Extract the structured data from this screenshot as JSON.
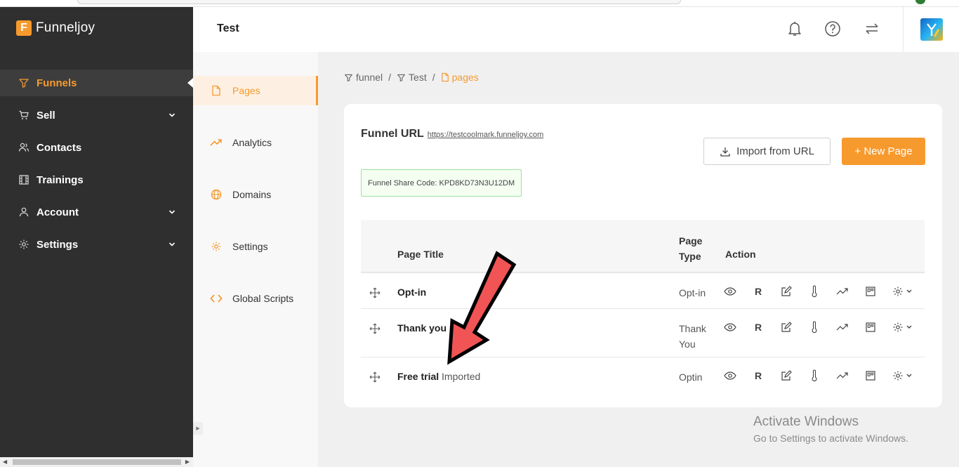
{
  "app": {
    "name": "Funneljoy",
    "logo_letter": "F",
    "accent": "#f79a2e"
  },
  "sidebar": {
    "items": [
      {
        "label": "Funnels",
        "icon": "funnel-icon",
        "active": true
      },
      {
        "label": "Sell",
        "icon": "cart-icon",
        "has_children": true
      },
      {
        "label": "Contacts",
        "icon": "users-icon"
      },
      {
        "label": "Trainings",
        "icon": "film-icon"
      },
      {
        "label": "Account",
        "icon": "user-icon",
        "has_children": true
      },
      {
        "label": "Settings",
        "icon": "gear-icon",
        "has_children": true
      }
    ]
  },
  "header": {
    "title": "Test",
    "icons": [
      "bell-icon",
      "help-icon",
      "switch-icon",
      "avatar"
    ]
  },
  "subnav": {
    "items": [
      {
        "label": "Pages",
        "icon": "page-icon",
        "active": true
      },
      {
        "label": "Analytics",
        "icon": "trend-icon"
      },
      {
        "label": "Domains",
        "icon": "globe-icon"
      },
      {
        "label": "Settings",
        "icon": "gear-icon"
      },
      {
        "label": "Global Scripts",
        "icon": "code-icon"
      }
    ]
  },
  "breadcrumb": {
    "items": [
      "funnel",
      "Test",
      "pages"
    ],
    "separator": "/"
  },
  "card": {
    "funnel_url_label": "Funnel URL",
    "funnel_url": "https://testcoolmark.funneljoy.com",
    "share_code": "Funnel Share Code: KPD8KD73N3U12DM",
    "import_label": "Import from URL",
    "new_page_label": "+ New Page"
  },
  "table": {
    "headers": {
      "title": "Page Title",
      "type": "Page Type",
      "action": "Action"
    },
    "action_icons": [
      "eye-icon",
      "r-icon",
      "edit-icon",
      "thermometer-icon",
      "trend-icon",
      "template-icon",
      "gear-dropdown-icon"
    ],
    "action_r_label": "R",
    "rows": [
      {
        "title": "Opt-in",
        "tag": "",
        "type": "Opt-in"
      },
      {
        "title": "Thank you",
        "tag": "",
        "type": "Thank You"
      },
      {
        "title": "Free trial",
        "tag": "Imported",
        "type": "Optin"
      }
    ]
  },
  "watermark": {
    "line1": "Activate Windows",
    "line2": "Go to Settings to activate Windows."
  }
}
